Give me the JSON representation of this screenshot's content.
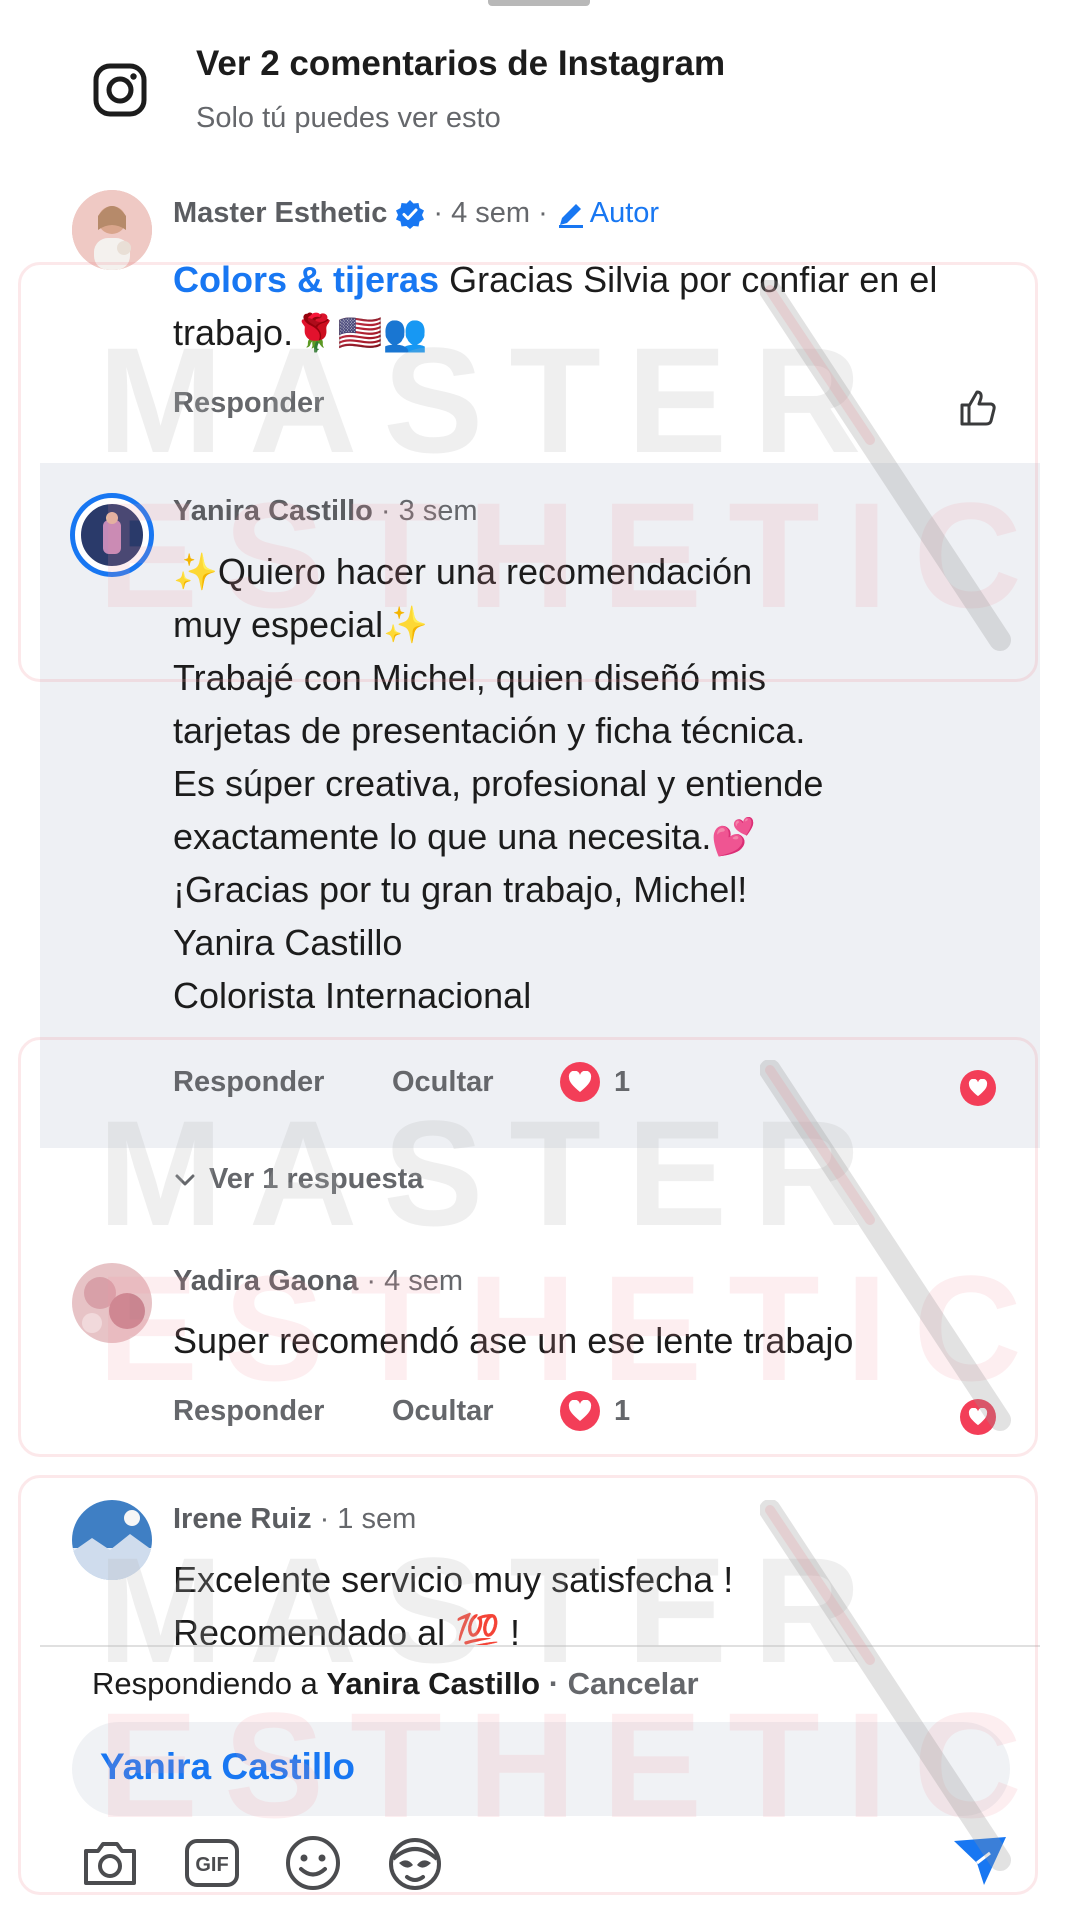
{
  "header": {
    "title": "Ver 2 comentarios de Instagram",
    "subtitle": "Solo tú puedes ver esto"
  },
  "comments": [
    {
      "author": "Master Esthetic",
      "time": "· 4 sem ·",
      "badge": "Autor",
      "mention": "Colors & tijeras",
      "text": "Gracias Silvia por confiar en el trabajo.🌹🇺🇸👥",
      "reply_label": "Responder"
    },
    {
      "author": "Yanira Castillo",
      "time": "· 3 sem",
      "lines": [
        "✨Quiero hacer una recomendación",
        "muy especial✨",
        "Trabajé con Michel, quien diseñó mis",
        "tarjetas de presentación y ficha técnica.",
        "Es súper creativa, profesional y entiende",
        "exactamente lo que una necesita.💕",
        "¡Gracias por tu gran trabajo, Michel!",
        "Yanira Castillo",
        "Colorista Internacional"
      ],
      "reply_label": "Responder",
      "hide_label": "Ocultar",
      "reaction_count": "1",
      "view_replies": "Ver 1 respuesta"
    },
    {
      "author": "Yadira Gaona",
      "time": "· 4 sem",
      "text": "Super recomendó ase un ese lente trabajo",
      "reply_label": "Responder",
      "hide_label": "Ocultar",
      "reaction_count": "1"
    },
    {
      "author": "Irene Ruiz",
      "time": "· 1 sem",
      "lines": [
        "Excelente servicio muy satisfecha !",
        "Recomendado al 💯 !"
      ]
    }
  ],
  "composer": {
    "replying_prefix": "Respondiendo a",
    "replying_to": "Yanira Castillo",
    "separator": "·",
    "cancel": "Cancelar",
    "input_value": "Yanira Castillo"
  },
  "watermark": {
    "line1": "MASTER",
    "line2": "ESTHETIC"
  },
  "colors": {
    "accent": "#1877f2",
    "love": "#f33e58",
    "highlight": "#eef0f4"
  }
}
